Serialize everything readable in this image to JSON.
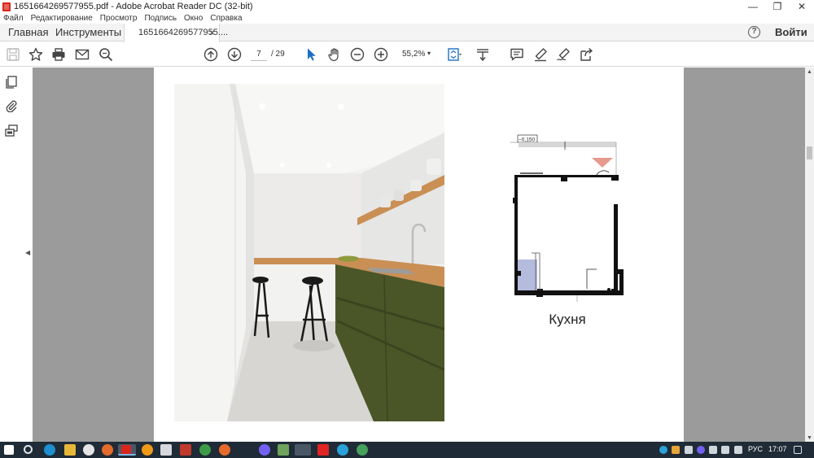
{
  "window": {
    "title": "1651664269577955.pdf - Adobe Acrobat Reader DC (32-bit)",
    "controls": {
      "minimize": "—",
      "maximize": "❐",
      "close": "✕"
    }
  },
  "menu": {
    "items": [
      "Файл",
      "Редактирование",
      "Просмотр",
      "Подпись",
      "Окно",
      "Справка"
    ]
  },
  "tabs": {
    "home": "Главная",
    "tools": "Инструменты",
    "document": "1651664269577955....",
    "close": "×",
    "help": "?",
    "signin": "Войти"
  },
  "toolbar": {
    "page_current": "7",
    "page_total": "/ 29",
    "zoom": "55,2%",
    "zoom_caret": "▾",
    "icons": [
      "save-icon",
      "star-icon",
      "print-icon",
      "email-icon",
      "search-icon",
      "prev-page-icon",
      "next-page-icon",
      "select-arrow-icon",
      "hand-icon",
      "zoom-out-icon",
      "zoom-in-icon",
      "fit-page-icon",
      "scroll-mode-icon",
      "comment-icon",
      "highlight-icon",
      "sign-icon",
      "share-icon"
    ]
  },
  "sidebar": {
    "icons": [
      "pages-icon",
      "attachment-icon",
      "layers-icon"
    ],
    "collapse": "◀"
  },
  "document": {
    "plan_marker": "−0,150",
    "plan_caption": "Кухня",
    "colors": {
      "cabinet_green": "#4a5627",
      "wood": "#c98f55",
      "plan_wall": "#111111",
      "plan_fill": "#b4bbdc",
      "plan_triangle": "#e69a8e"
    }
  },
  "scrollbar": {
    "up": "▲",
    "down": "▼"
  },
  "taskbar": {
    "icons": [
      "start-icon",
      "taskbar-search-icon",
      "edge-icon",
      "explorer-icon",
      "yandex-icon",
      "app-icon-1",
      "acrobat-icon",
      "app-icon-2",
      "app-icon-3",
      "app-icon-4",
      "chrome-icon",
      "firefox-icon",
      "viber-icon",
      "app-icon-5",
      "chrome-icon-2",
      "youtube-icon",
      "telegram-icon",
      "app-icon-6"
    ],
    "language": "РУС",
    "time": "17:07"
  }
}
